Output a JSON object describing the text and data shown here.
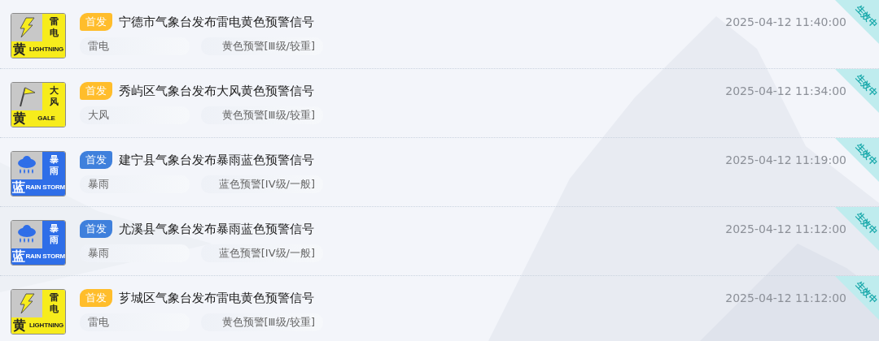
{
  "warnings": [
    {
      "icon": {
        "kind": "lightning",
        "name_chars": "雷电",
        "level_char": "黄",
        "english": "LIGHTNING",
        "color": "#f7ec1c"
      },
      "tag": {
        "label": "首发",
        "color": "#ffbd2b"
      },
      "title": "宁德市气象台发布雷电黄色预警信号",
      "type": "雷电",
      "level": "黄色预警[Ⅲ级/较重]",
      "time": "2025-04-12 11:40:00",
      "status": "生效中"
    },
    {
      "icon": {
        "kind": "gale",
        "name_chars": "大风",
        "level_char": "黄",
        "english": "GALE",
        "color": "#f7ec1c"
      },
      "tag": {
        "label": "首发",
        "color": "#ffbd2b"
      },
      "title": "秀屿区气象台发布大风黄色预警信号",
      "type": "大风",
      "level": "黄色预警[Ⅲ级/较重]",
      "time": "2025-04-12 11:34:00",
      "status": "生效中"
    },
    {
      "icon": {
        "kind": "rainstorm",
        "name_chars": "暴雨",
        "level_char": "蓝",
        "english": "RAIN STORM",
        "color": "#2f6ee8"
      },
      "tag": {
        "label": "首发",
        "color": "#3f80dc"
      },
      "title": "建宁县气象台发布暴雨蓝色预警信号",
      "type": "暴雨",
      "level": "蓝色预警[IV级/一般]",
      "time": "2025-04-12 11:19:00",
      "status": "生效中"
    },
    {
      "icon": {
        "kind": "rainstorm",
        "name_chars": "暴雨",
        "level_char": "蓝",
        "english": "RAIN STORM",
        "color": "#2f6ee8"
      },
      "tag": {
        "label": "首发",
        "color": "#3f80dc"
      },
      "title": "尤溪县气象台发布暴雨蓝色预警信号",
      "type": "暴雨",
      "level": "蓝色预警[IV级/一般]",
      "time": "2025-04-12 11:12:00",
      "status": "生效中"
    },
    {
      "icon": {
        "kind": "lightning",
        "name_chars": "雷电",
        "level_char": "黄",
        "english": "LIGHTNING",
        "color": "#f7ec1c"
      },
      "tag": {
        "label": "首发",
        "color": "#ffbd2b"
      },
      "title": "芗城区气象台发布雷电黄色预警信号",
      "type": "雷电",
      "level": "黄色预警[Ⅲ级/较重]",
      "time": "2025-04-12 11:12:00",
      "status": "生效中"
    }
  ]
}
